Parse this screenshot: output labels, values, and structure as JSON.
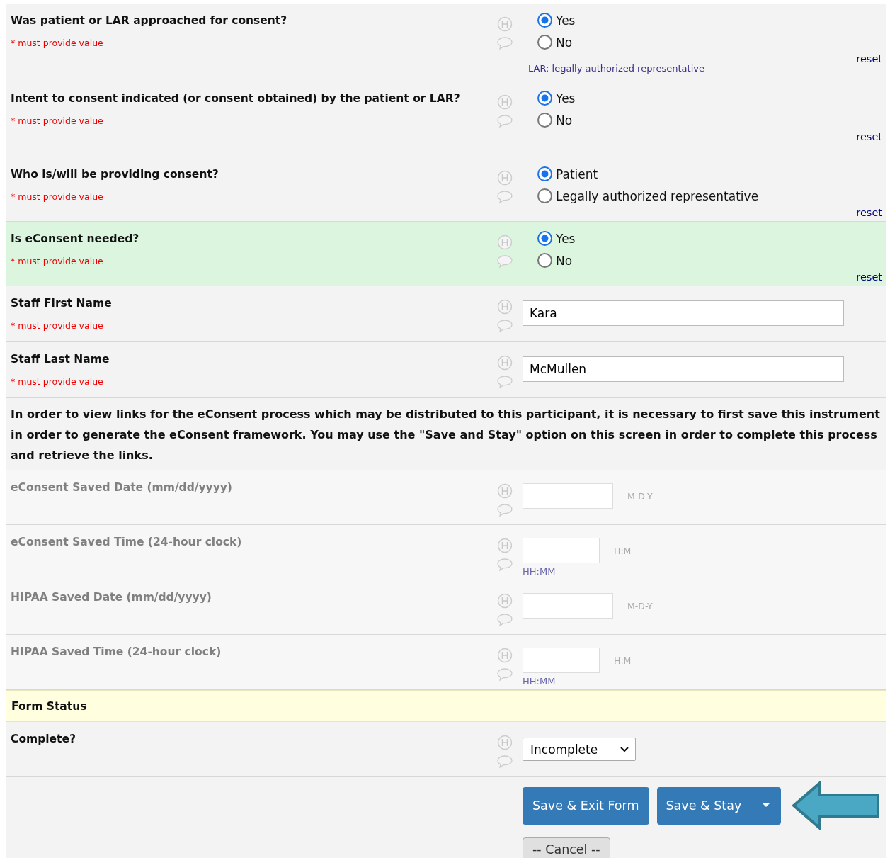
{
  "fields": [
    {
      "kind": "radio",
      "label": "Was patient or LAR approached for consent?",
      "required": "* must provide value",
      "highlighted": false,
      "options": [
        {
          "label": "Yes",
          "selected": true
        },
        {
          "label": "No",
          "selected": false
        }
      ],
      "note": "LAR: legally authorized representative",
      "reset": "reset"
    },
    {
      "kind": "radio",
      "label": "Intent to consent indicated (or consent obtained) by the patient or LAR?",
      "required": "* must provide value",
      "highlighted": false,
      "options": [
        {
          "label": "Yes",
          "selected": true
        },
        {
          "label": "No",
          "selected": false
        }
      ],
      "reset": "reset"
    },
    {
      "kind": "radio",
      "label": "Who is/will be providing consent?",
      "required": "* must provide value",
      "highlighted": false,
      "options": [
        {
          "label": "Patient",
          "selected": true
        },
        {
          "label": "Legally authorized representative",
          "selected": false
        }
      ],
      "reset": "reset"
    },
    {
      "kind": "radio",
      "label": "Is eConsent needed?",
      "required": "* must provide value",
      "highlighted": true,
      "options": [
        {
          "label": "Yes",
          "selected": true
        },
        {
          "label": "No",
          "selected": false
        }
      ],
      "reset": "reset"
    },
    {
      "kind": "text",
      "label": "Staff First Name",
      "required": "* must provide value",
      "value": "Kara"
    },
    {
      "kind": "text",
      "label": "Staff Last Name",
      "required": "* must provide value",
      "value": "McMullen"
    },
    {
      "kind": "info",
      "text": "In order to view links for the eConsent process which may be distributed to this participant, it is necessary to first save this instrument in order to generate the eConsent framework.  You may use the \"Save and Stay\" option on this screen in order to complete this process and retrieve the links."
    },
    {
      "kind": "date",
      "label": "eConsent Saved Date (mm/dd/yyyy)",
      "disabled": true,
      "format": "M-D-Y"
    },
    {
      "kind": "time",
      "label": "eConsent Saved Time (24-hour clock)",
      "disabled": true,
      "format": "H:M",
      "hint": "HH:MM"
    },
    {
      "kind": "date",
      "label": "HIPAA Saved Date (mm/dd/yyyy)",
      "disabled": true,
      "format": "M-D-Y"
    },
    {
      "kind": "time",
      "label": "HIPAA Saved Time (24-hour clock)",
      "disabled": true,
      "format": "H:M",
      "hint": "HH:MM"
    },
    {
      "kind": "section",
      "label": "Form Status"
    },
    {
      "kind": "select",
      "label": "Complete?",
      "value": "Incomplete"
    }
  ],
  "buttons": {
    "save_exit": "Save & Exit Form",
    "save_stay": "Save & Stay",
    "cancel": "-- Cancel --"
  }
}
